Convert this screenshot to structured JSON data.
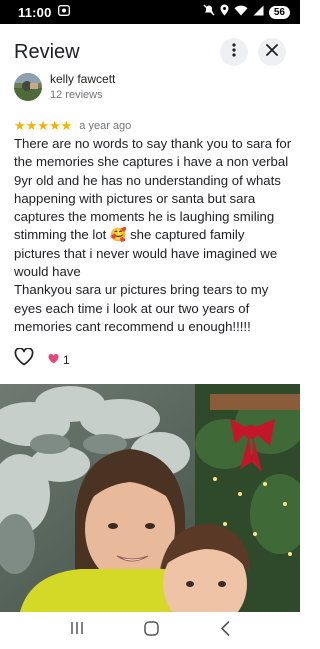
{
  "status": {
    "time": "11:00",
    "battery": "56"
  },
  "header": {
    "title": "Review"
  },
  "reviewer": {
    "name": "kelly fawcett",
    "reviews": "12 reviews"
  },
  "rating": {
    "stars": "★★★★★",
    "value": 5,
    "date": "a year ago"
  },
  "review": {
    "lines": [
      "There are no words to say thank you to sara for",
      "the memories she captures i have a non verbal",
      "9yr old and he has no understanding of whats",
      "happening with pictures or santa but sara",
      "captures the moments he is laughing smiling",
      "stimming the lot 🥰 she captured family",
      "pictures that i never would have imagined we",
      "would have",
      "Thankyou sara ur pictures bring tears to my",
      "eyes each time i look at our two years of",
      "memories cant recommend u enough!!!!!"
    ]
  },
  "reactions": {
    "like_count": "1"
  },
  "icons": {
    "more": "more-vert-icon",
    "close": "close-icon",
    "heart": "heart-outline-icon",
    "reaction": "heart-reaction-icon"
  },
  "colors": {
    "star": "#f4b400",
    "reaction_heart": "#e8437a"
  }
}
